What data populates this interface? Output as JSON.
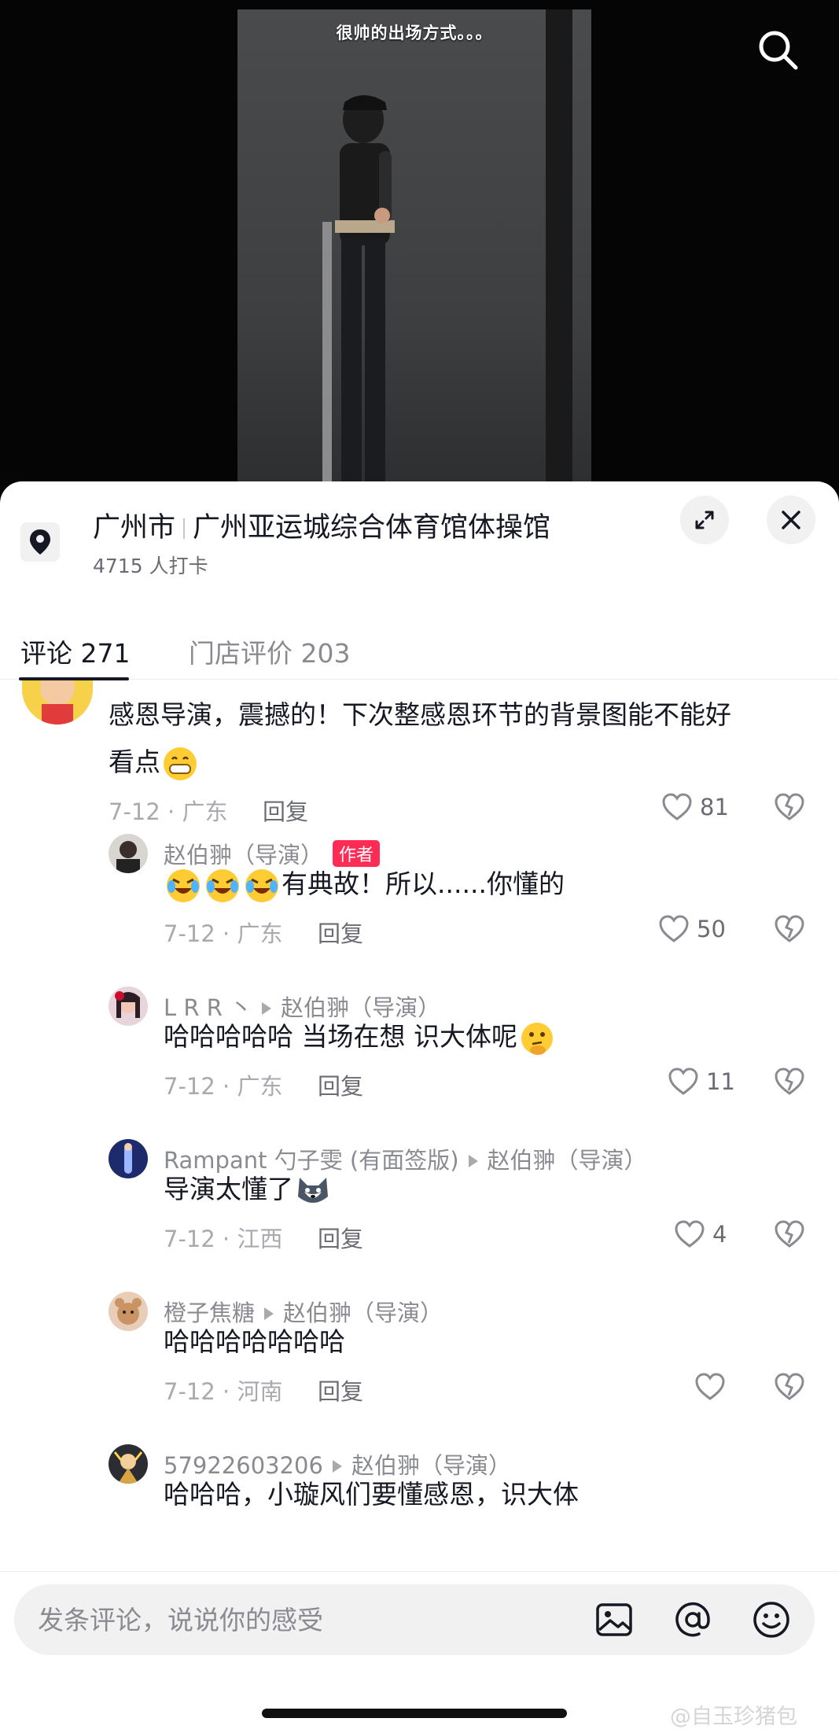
{
  "video": {
    "caption": "很帅的出场方式。。。"
  },
  "location": {
    "city": "广州市",
    "venue": "广州亚运城综合体育馆体操馆",
    "checkins": "4715 人打卡"
  },
  "tabs": {
    "comments": "评论 271",
    "reviews": "门店评价 203"
  },
  "comments": [
    {
      "text_line1": "感恩导演，震撼的！下次整感恩环节的背景图能不能好",
      "text_line2": "看点",
      "meta": "7-12 · 广东",
      "reply": "回复",
      "likes": "81"
    },
    {
      "name": "赵伯翀（导演）",
      "badge": "作者",
      "text": "有典故！所以......你懂的",
      "meta": "7-12 · 广东",
      "reply": "回复",
      "likes": "50"
    },
    {
      "name": "L R R 丶",
      "reply_to": "赵伯翀（导演）",
      "text": "哈哈哈哈哈 当场在想 识大体呢",
      "meta": "7-12 · 广东",
      "reply": "回复",
      "likes": "11"
    },
    {
      "name": "Rampant 勺子雯 (有面签版)",
      "reply_to": "赵伯翀（导演）",
      "text": "导演太懂了",
      "meta": "7-12 · 江西",
      "reply": "回复",
      "likes": "4"
    },
    {
      "name": "橙子焦糖",
      "reply_to": "赵伯翀（导演）",
      "text": "哈哈哈哈哈哈哈",
      "meta": "7-12 · 河南",
      "reply": "回复",
      "likes": ""
    },
    {
      "name": "57922603206",
      "reply_to": "赵伯翀（导演）",
      "text": "哈哈哈，小璇风们要懂感恩，识大体"
    }
  ],
  "input": {
    "placeholder": "发条评论，说说你的感受"
  },
  "watermark": "@自玉珍猪包",
  "colors": {
    "accent": "#fe2c55",
    "text_primary": "#161823",
    "text_secondary": "#8a8b91"
  },
  "icons": [
    "search-icon",
    "location-pin-icon",
    "expand-icon",
    "close-icon",
    "heart-icon",
    "broken-heart-icon",
    "image-icon",
    "at-icon",
    "emoji-icon"
  ]
}
